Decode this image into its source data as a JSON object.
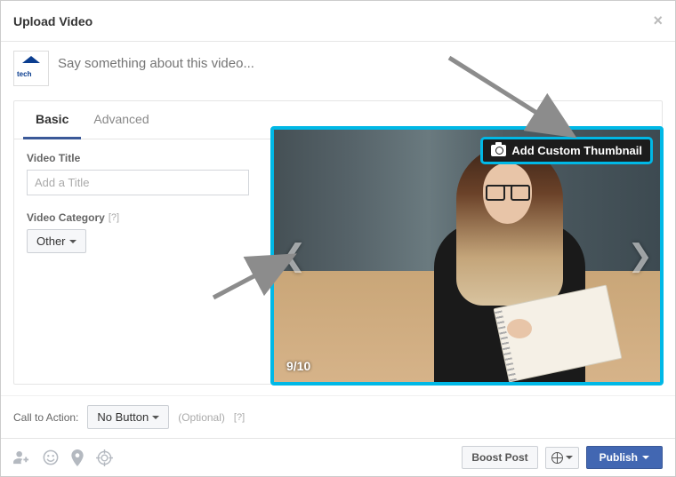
{
  "header": {
    "title": "Upload Video"
  },
  "composer": {
    "placeholder": "Say something about this video..."
  },
  "tabs": {
    "basic": "Basic",
    "advanced": "Advanced"
  },
  "form": {
    "title_label": "Video Title",
    "title_placeholder": "Add a Title",
    "category_label": "Video Category",
    "category_help": "[?]",
    "category_value": "Other"
  },
  "preview": {
    "counter": "9/10",
    "add_custom": "Add Custom Thumbnail"
  },
  "cta": {
    "label": "Call to Action:",
    "value": "No Button",
    "optional": "(Optional)",
    "help": "[?]"
  },
  "footer": {
    "boost": "Boost Post",
    "publish": "Publish"
  }
}
